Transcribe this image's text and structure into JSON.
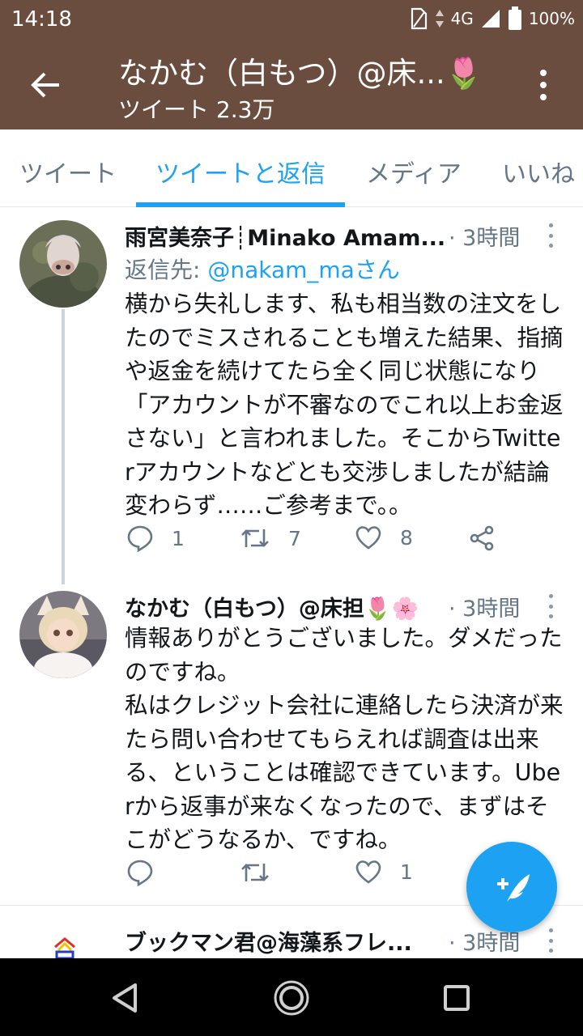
{
  "status_bar": {
    "time": "14:18",
    "network": "4G",
    "battery": "100%"
  },
  "header": {
    "title": "なかむ（白もつ）@床...🌷",
    "subtitle": "ツイート 2.3万"
  },
  "tabs": [
    {
      "label": "ツイート",
      "active": false
    },
    {
      "label": "ツイートと返信",
      "active": true
    },
    {
      "label": "メディア",
      "active": false
    },
    {
      "label": "いいね",
      "active": false
    }
  ],
  "tweets": [
    {
      "name": "雨宮美奈子┊Minako Amam...",
      "time": "· 3時間",
      "reply_prefix": "返信先: ",
      "reply_handle": "@nakam_maさん",
      "text": "横から失礼します、私も相当数の注文をしたのでミスされることも増えた結果、指摘や返金を続けてたら全く同じ状態になり「アカウントが不審なのでこれ以上お金返さない」と言われました。そこからTwitterアカウントなどとも交渉しましたが結論変わらず……ご参考まで。。",
      "reply_count": "1",
      "retweet_count": "7",
      "like_count": "8"
    },
    {
      "name": "なかむ（白もつ）@床担🌷🌸",
      "time": "· 3時間",
      "text": "情報ありがとうございました。ダメだったのですね。\n私はクレジット会社に連絡したら決済が来たら問い合わせてもらえれば調査は出来る、ということは確認できています。Uberから返事が来なくなったので、まずはそこがどうなるか、ですね。",
      "reply_count": "",
      "retweet_count": "",
      "like_count": "1"
    },
    {
      "name": "ブックマン君@海藻系フレ...",
      "time": "· 3時間"
    }
  ],
  "colors": {
    "header_bg": "#6a4d3e",
    "accent": "#1da1f2",
    "muted": "#657786"
  },
  "icons": [
    "back-arrow-icon",
    "more-vert-icon",
    "reply-icon",
    "retweet-icon",
    "like-icon",
    "share-icon",
    "compose-icon",
    "nav-back-icon",
    "nav-home-icon",
    "nav-recents-icon"
  ]
}
